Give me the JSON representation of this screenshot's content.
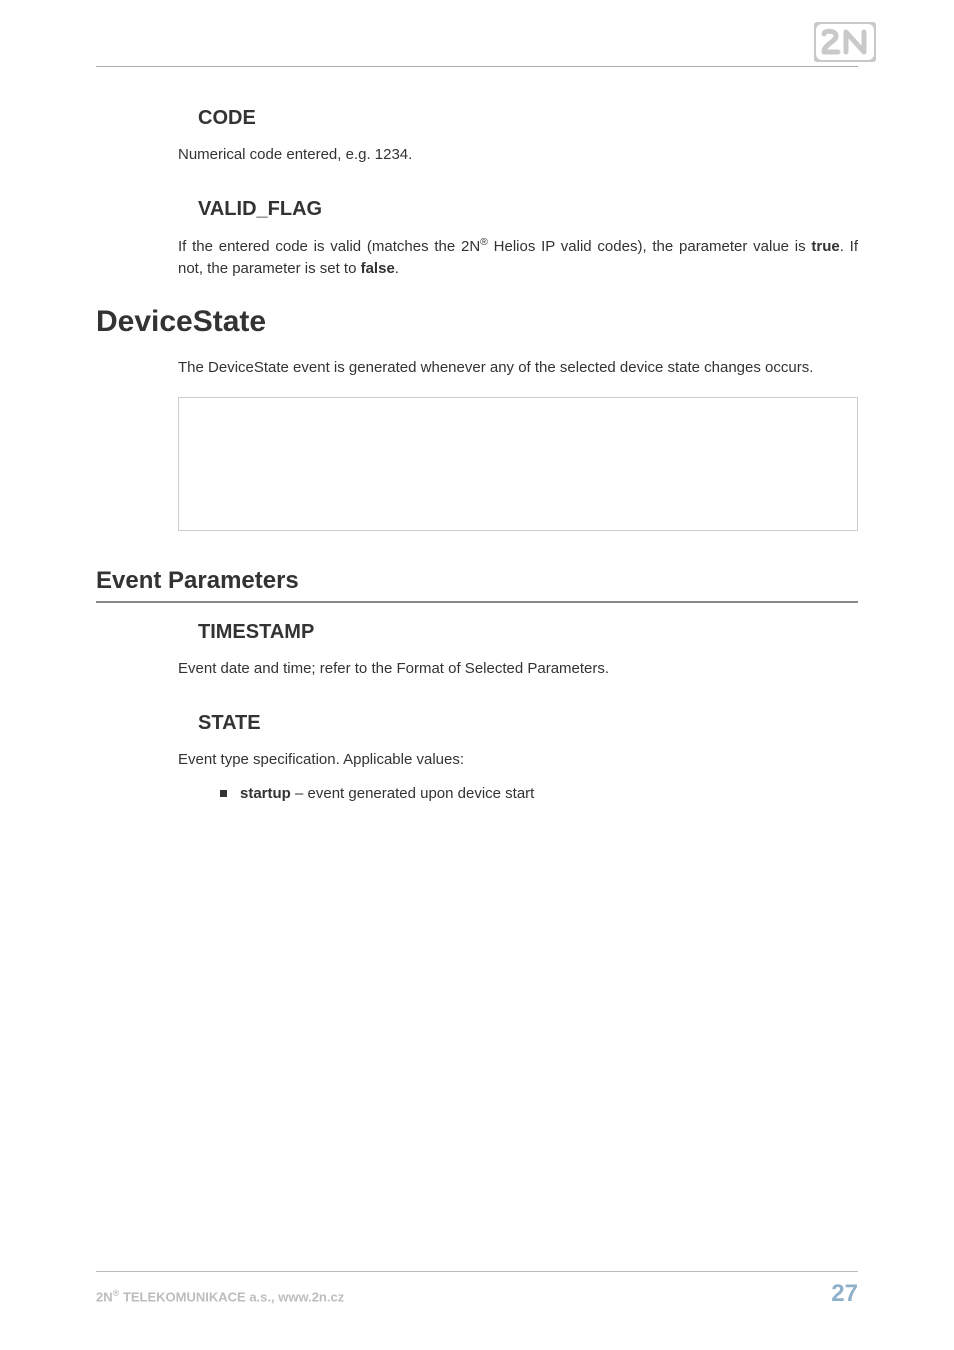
{
  "logo": {
    "name": "2N"
  },
  "sections": {
    "code": {
      "heading": "CODE",
      "text": "Numerical code entered, e.g. 1234."
    },
    "valid_flag": {
      "heading": "VALID_FLAG",
      "t1": "If the entered code is valid (matches the 2N",
      "t2": " Helios IP valid codes), the parameter value is ",
      "bold1": "true",
      "t3": ". If not, the parameter is set to ",
      "bold2": "false",
      "t4": "."
    },
    "device_state": {
      "heading": "DeviceState",
      "text": "The DeviceState event is generated whenever any of the selected device state changes occurs."
    },
    "event_params": {
      "heading": "Event Parameters"
    },
    "timestamp": {
      "heading": "TIMESTAMP",
      "text": "Event date and time; refer to the Format of Selected Parameters."
    },
    "state": {
      "heading": "STATE",
      "text": "Event type specification. Applicable values:",
      "item_bold": "startup",
      "item_rest": " – event generated upon device start"
    }
  },
  "footer": {
    "left_1": "2N",
    "left_2": " TELEKOMUNIKACE a.s., www.2n.cz",
    "page": "27"
  }
}
